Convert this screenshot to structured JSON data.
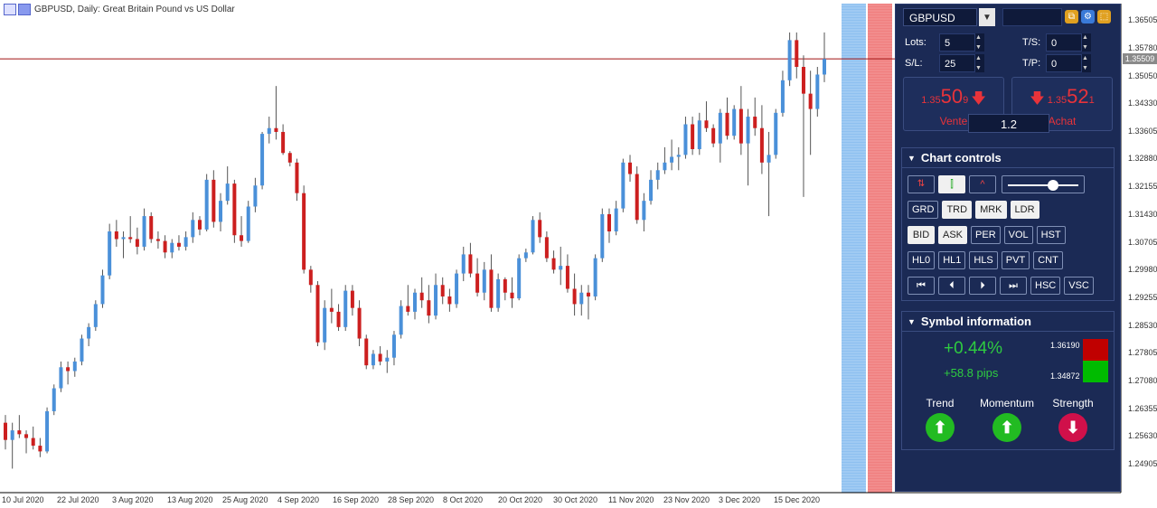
{
  "chart": {
    "header_title": "GBPUSD, Daily:  Great Britain Pound vs US Dollar",
    "price_axis": [
      "1.36505",
      "1.35780",
      "1.35050",
      "1.34330",
      "1.33605",
      "1.32880",
      "1.32155",
      "1.31430",
      "1.30705",
      "1.29980",
      "1.29255",
      "1.28530",
      "1.27805",
      "1.27080",
      "1.26355",
      "1.25630",
      "1.24905"
    ],
    "date_axis": [
      "10 Jul 2020",
      "22 Jul 2020",
      "3 Aug 2020",
      "13 Aug 2020",
      "25 Aug 2020",
      "4 Sep 2020",
      "16 Sep 2020",
      "28 Sep 2020",
      "8 Oct 2020",
      "20 Oct 2020",
      "30 Oct 2020",
      "11 Nov 2020",
      "23 Nov 2020",
      "3 Dec 2020",
      "15 Dec 2020"
    ],
    "current_price": "1.35509",
    "bull_color": "#4a90d9",
    "bear_color": "#cc1f1f",
    "ohlc": [
      [
        1.26,
        1.262,
        1.253,
        1.2555
      ],
      [
        1.2555,
        1.26,
        1.248,
        1.258
      ],
      [
        1.258,
        1.262,
        1.256,
        1.257
      ],
      [
        1.257,
        1.258,
        1.252,
        1.256
      ],
      [
        1.256,
        1.259,
        1.253,
        1.254
      ],
      [
        1.254,
        1.256,
        1.251,
        1.2525
      ],
      [
        1.2525,
        1.264,
        1.252,
        1.263
      ],
      [
        1.263,
        1.27,
        1.262,
        1.269
      ],
      [
        1.269,
        1.276,
        1.268,
        1.2745
      ],
      [
        1.2745,
        1.276,
        1.27,
        1.2735
      ],
      [
        1.2735,
        1.277,
        1.272,
        1.276
      ],
      [
        1.276,
        1.283,
        1.275,
        1.282
      ],
      [
        1.282,
        1.286,
        1.28,
        1.285
      ],
      [
        1.285,
        1.292,
        1.284,
        1.291
      ],
      [
        1.291,
        1.3,
        1.29,
        1.2985
      ],
      [
        1.2985,
        1.312,
        1.2975,
        1.31
      ],
      [
        1.31,
        1.313,
        1.306,
        1.308
      ],
      [
        1.308,
        1.31,
        1.303,
        1.3085
      ],
      [
        1.3085,
        1.314,
        1.307,
        1.308
      ],
      [
        1.308,
        1.311,
        1.304,
        1.306
      ],
      [
        1.306,
        1.316,
        1.305,
        1.314
      ],
      [
        1.314,
        1.315,
        1.307,
        1.308
      ],
      [
        1.308,
        1.31,
        1.3055,
        1.3075
      ],
      [
        1.3075,
        1.309,
        1.303,
        1.3045
      ],
      [
        1.3045,
        1.308,
        1.303,
        1.307
      ],
      [
        1.307,
        1.309,
        1.305,
        1.306
      ],
      [
        1.306,
        1.31,
        1.305,
        1.3085
      ],
      [
        1.3085,
        1.315,
        1.307,
        1.313
      ],
      [
        1.313,
        1.314,
        1.309,
        1.3105
      ],
      [
        1.3105,
        1.325,
        1.31,
        1.3235
      ],
      [
        1.3235,
        1.326,
        1.311,
        1.3125
      ],
      [
        1.3125,
        1.32,
        1.31,
        1.318
      ],
      [
        1.318,
        1.327,
        1.317,
        1.3225
      ],
      [
        1.3225,
        1.3235,
        1.307,
        1.309
      ],
      [
        1.309,
        1.314,
        1.306,
        1.3075
      ],
      [
        1.3075,
        1.318,
        1.307,
        1.3165
      ],
      [
        1.3165,
        1.324,
        1.315,
        1.322
      ],
      [
        1.322,
        1.336,
        1.321,
        1.3355
      ],
      [
        1.3355,
        1.34,
        1.333,
        1.337
      ],
      [
        1.337,
        1.348,
        1.334,
        1.336
      ],
      [
        1.336,
        1.338,
        1.33,
        1.3305
      ],
      [
        1.3305,
        1.331,
        1.327,
        1.328
      ],
      [
        1.328,
        1.329,
        1.318,
        1.32
      ],
      [
        1.32,
        1.322,
        1.299,
        1.3
      ],
      [
        1.3,
        1.301,
        1.294,
        1.296
      ],
      [
        1.296,
        1.297,
        1.28,
        1.281
      ],
      [
        1.281,
        1.292,
        1.279,
        1.29
      ],
      [
        1.29,
        1.295,
        1.286,
        1.289
      ],
      [
        1.289,
        1.291,
        1.284,
        1.285
      ],
      [
        1.285,
        1.296,
        1.284,
        1.2945
      ],
      [
        1.2945,
        1.296,
        1.288,
        1.29
      ],
      [
        1.29,
        1.292,
        1.28,
        1.282
      ],
      [
        1.282,
        1.283,
        1.274,
        1.275
      ],
      [
        1.275,
        1.279,
        1.274,
        1.278
      ],
      [
        1.278,
        1.28,
        1.275,
        1.276
      ],
      [
        1.276,
        1.279,
        1.273,
        1.277
      ],
      [
        1.277,
        1.284,
        1.275,
        1.283
      ],
      [
        1.283,
        1.292,
        1.282,
        1.2905
      ],
      [
        1.2905,
        1.296,
        1.288,
        1.289
      ],
      [
        1.289,
        1.295,
        1.287,
        1.294
      ],
      [
        1.294,
        1.298,
        1.29,
        1.292
      ],
      [
        1.292,
        1.296,
        1.286,
        1.288
      ],
      [
        1.288,
        1.299,
        1.287,
        1.296
      ],
      [
        1.296,
        1.298,
        1.291,
        1.293
      ],
      [
        1.293,
        1.295,
        1.289,
        1.291
      ],
      [
        1.291,
        1.3,
        1.29,
        1.299
      ],
      [
        1.299,
        1.306,
        1.297,
        1.304
      ],
      [
        1.304,
        1.307,
        1.298,
        1.299
      ],
      [
        1.299,
        1.303,
        1.293,
        1.294
      ],
      [
        1.294,
        1.302,
        1.292,
        1.3
      ],
      [
        1.3,
        1.304,
        1.289,
        1.29
      ],
      [
        1.29,
        1.299,
        1.289,
        1.2975
      ],
      [
        1.2975,
        1.298,
        1.292,
        1.294
      ],
      [
        1.294,
        1.298,
        1.29,
        1.2925
      ],
      [
        1.2925,
        1.304,
        1.292,
        1.303
      ],
      [
        1.303,
        1.3055,
        1.302,
        1.3045
      ],
      [
        1.3045,
        1.314,
        1.304,
        1.313
      ],
      [
        1.313,
        1.315,
        1.307,
        1.3085
      ],
      [
        1.3085,
        1.31,
        1.302,
        1.303
      ],
      [
        1.303,
        1.305,
        1.299,
        1.3
      ],
      [
        1.3,
        1.306,
        1.296,
        1.301
      ],
      [
        1.301,
        1.304,
        1.294,
        1.295
      ],
      [
        1.295,
        1.299,
        1.288,
        1.291
      ],
      [
        1.291,
        1.296,
        1.288,
        1.294
      ],
      [
        1.294,
        1.296,
        1.287,
        1.293
      ],
      [
        1.293,
        1.304,
        1.292,
        1.303
      ],
      [
        1.303,
        1.316,
        1.302,
        1.3145
      ],
      [
        1.3145,
        1.316,
        1.307,
        1.31
      ],
      [
        1.31,
        1.318,
        1.309,
        1.316
      ],
      [
        1.316,
        1.329,
        1.315,
        1.328
      ],
      [
        1.328,
        1.33,
        1.323,
        1.325
      ],
      [
        1.325,
        1.327,
        1.312,
        1.313
      ],
      [
        1.313,
        1.32,
        1.31,
        1.318
      ],
      [
        1.318,
        1.326,
        1.317,
        1.3235
      ],
      [
        1.3235,
        1.328,
        1.321,
        1.326
      ],
      [
        1.326,
        1.332,
        1.325,
        1.328
      ],
      [
        1.328,
        1.334,
        1.326,
        1.3295
      ],
      [
        1.3295,
        1.332,
        1.326,
        1.33
      ],
      [
        1.33,
        1.34,
        1.329,
        1.338
      ],
      [
        1.338,
        1.34,
        1.33,
        1.3315
      ],
      [
        1.3315,
        1.341,
        1.33,
        1.339
      ],
      [
        1.339,
        1.344,
        1.336,
        1.337
      ],
      [
        1.337,
        1.338,
        1.332,
        1.333
      ],
      [
        1.333,
        1.342,
        1.328,
        1.341
      ],
      [
        1.341,
        1.345,
        1.334,
        1.335
      ],
      [
        1.335,
        1.343,
        1.334,
        1.342
      ],
      [
        1.342,
        1.348,
        1.33,
        1.333
      ],
      [
        1.333,
        1.342,
        1.322,
        1.34
      ],
      [
        1.34,
        1.345,
        1.335,
        1.337
      ],
      [
        1.337,
        1.343,
        1.325,
        1.328
      ],
      [
        1.328,
        1.336,
        1.314,
        1.33
      ],
      [
        1.33,
        1.342,
        1.329,
        1.341
      ],
      [
        1.341,
        1.352,
        1.34,
        1.3495
      ],
      [
        1.3495,
        1.362,
        1.348,
        1.36
      ],
      [
        1.36,
        1.362,
        1.35,
        1.353
      ],
      [
        1.353,
        1.356,
        1.319,
        1.346
      ],
      [
        1.346,
        1.352,
        1.33,
        1.342
      ],
      [
        1.342,
        1.353,
        1.34,
        1.351
      ],
      [
        1.351,
        1.362,
        1.349,
        1.3551
      ]
    ]
  },
  "panel": {
    "symbol": "GBPUSD",
    "lots_label": "Lots:",
    "lots_value": "5",
    "ts_label": "T/S:",
    "ts_value": "0",
    "sl_label": "S/L:",
    "sl_value": "25",
    "tp_label": "T/P:",
    "tp_value": "0",
    "sell_price_small": "1.35",
    "sell_price_big": "50",
    "sell_price_sup": "9",
    "sell_label": "Vente",
    "buy_price_small": "1.35",
    "buy_price_big": "52",
    "buy_price_sup": "1",
    "buy_label": "Achat",
    "spread": "1.2",
    "chart_controls_title": "Chart controls",
    "row1": [
      "GRD",
      "TRD",
      "MRK",
      "LDR"
    ],
    "row2": [
      "BID",
      "ASK",
      "PER",
      "VOL",
      "HST"
    ],
    "row3": [
      "HL0",
      "HL1",
      "HLS",
      "PVT",
      "CNT"
    ],
    "row4_labels": [
      "HSC",
      "VSC"
    ],
    "symbol_info_title": "Symbol information",
    "change_pct": "+0.44%",
    "change_pips": "+58.8 pips",
    "high": "1.36190",
    "low": "1.34872",
    "trend_label": "Trend",
    "momentum_label": "Momentum",
    "strength_label": "Strength",
    "trend_dir": "up",
    "momentum_dir": "up",
    "strength_dir": "down",
    "up_color": "#22bb22",
    "down_color": "#d0104a"
  }
}
